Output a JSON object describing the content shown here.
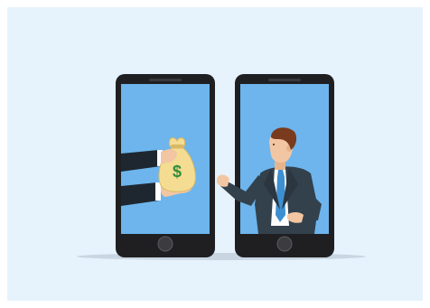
{
  "illustration": {
    "background_color": "#e6f2fc",
    "screen_color": "#6db5ec",
    "phone_color": "#1f1f22",
    "bag_color": "#f4dc93",
    "bag_symbol": "$",
    "bag_symbol_color": "#2f8e3a",
    "suit_color": "#33414d",
    "tie_color": "#3e8fd1",
    "skin_color": "#f2c6a2",
    "hair_color": "#7a3a1e"
  }
}
